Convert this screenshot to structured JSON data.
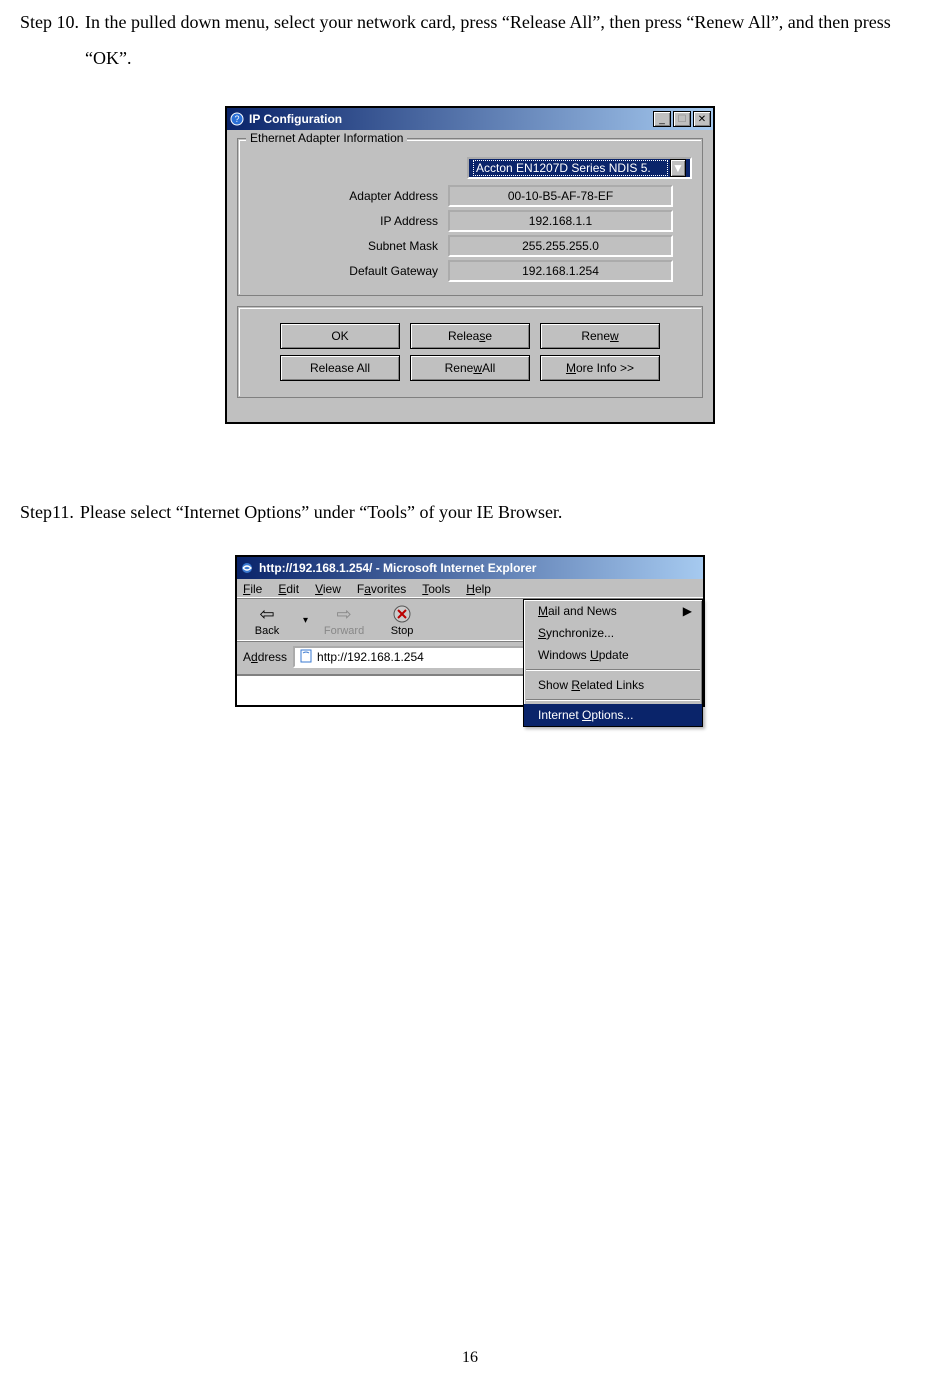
{
  "step10": {
    "label": "Step 10.",
    "text": "In the pulled down menu, select your network card, press “Release All”, then press “Renew All”, and then press “OK”."
  },
  "ipcfg": {
    "title": "IP Configuration",
    "groupLabel": "Ethernet  Adapter Information",
    "adapterSelected": "Accton EN1207D Series NDIS 5.",
    "fields": {
      "adapterAddress": {
        "label": "Adapter Address",
        "value": "00-10-B5-AF-78-EF"
      },
      "ipAddress": {
        "label": "IP Address",
        "value": "192.168.1.1"
      },
      "subnetMask": {
        "label": "Subnet Mask",
        "value": "255.255.255.0"
      },
      "defaultGateway": {
        "label": "Default Gateway",
        "value": "192.168.1.254"
      }
    },
    "buttons": {
      "ok": "OK",
      "release_pre": "Relea",
      "release_u": "s",
      "release_post": "e",
      "renew": "Rene",
      "renew_u": "w",
      "renew_post": "",
      "releaseAll": "Release All",
      "renewAll_pre": "Rene",
      "renewAll_u": "w",
      "renewAll_post": " All",
      "moreInfo_u": "M",
      "moreInfo_post": "ore Info >>"
    }
  },
  "step11": {
    "label": "Step11.",
    "text": " Please select “Internet Options” under “Tools” of your IE Browser."
  },
  "ie": {
    "title": "http://192.168.1.254/ - Microsoft Internet Explorer",
    "menu": {
      "file_u": "F",
      "file_post": "ile",
      "edit_u": "E",
      "edit_post": "dit",
      "view_u": "V",
      "view_post": "iew",
      "fav_pre": "F",
      "fav_u": "a",
      "fav_post": "vorites",
      "tools_u": "T",
      "tools_post": "ools",
      "help_u": "H",
      "help_post": "elp"
    },
    "toolbar": {
      "back": "Back",
      "forward": "Forward",
      "stop": "Stop"
    },
    "addressLabel_pre": "A",
    "addressLabel_u": "d",
    "addressLabel_post": "dress",
    "addressValue": "http://192.168.1.254",
    "toolsMenu": {
      "mailNews_u": "M",
      "mailNews_post": "ail and News",
      "sync_u": "S",
      "sync_post": "ynchronize...",
      "winUpdate_pre": "Windows ",
      "winUpdate_u": "U",
      "winUpdate_post": "pdate",
      "related_pre": "Show ",
      "related_u": "R",
      "related_post": "elated Links",
      "internetOptions_pre": "Internet ",
      "internetOptions_u": "O",
      "internetOptions_post": "ptions..."
    }
  },
  "pageNumber": "16"
}
